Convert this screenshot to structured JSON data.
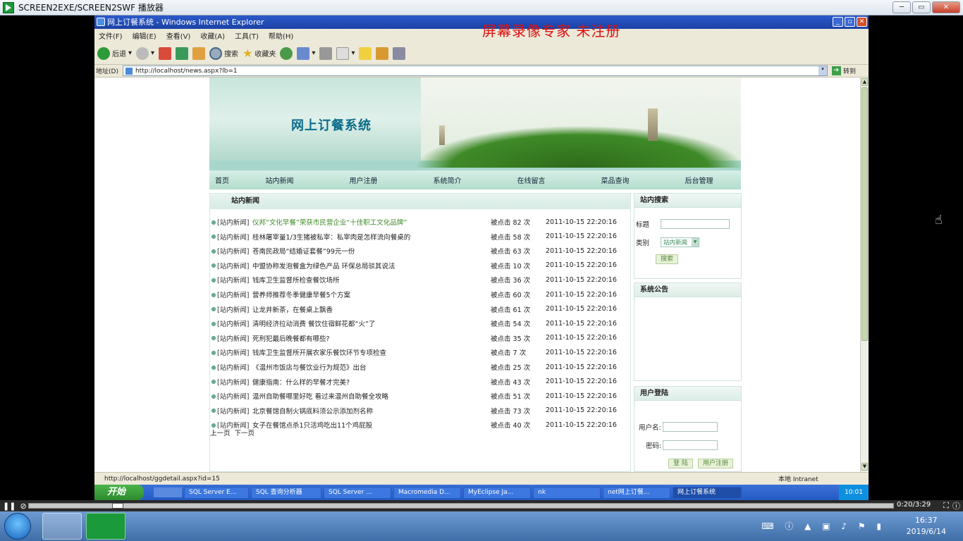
{
  "player": {
    "title": "SCREEN2EXE/SCREEN2SWF 播放器",
    "time": "0:20/3:29",
    "clock_time": "16:37",
    "clock_date": "2019/6/14"
  },
  "ie": {
    "title": "网上订餐系统 - Windows Internet Explorer",
    "watermark": "屏幕录像专家  未注册",
    "menu": [
      "文件(F)",
      "编辑(E)",
      "查看(V)",
      "收藏(A)",
      "工具(T)",
      "帮助(H)"
    ],
    "toolbar": {
      "back": "后退",
      "search": "搜索",
      "favorites": "收藏夹"
    },
    "address_label": "地址(D)",
    "address_value": "http://localhost/news.aspx?lb=1",
    "go_label": "转到",
    "status_url": "http://localhost/ggdetail.aspx?id=15",
    "status_zone": "本地 Intranet"
  },
  "site": {
    "title": "网上订餐系统",
    "nav": [
      "首页",
      "站内新闻",
      "用户注册",
      "系统简介",
      "在线留言",
      "菜品查询",
      "后台管理"
    ],
    "news_header": "站内新闻",
    "news": [
      {
        "cat": "[站内新闻]",
        "title": "仪邦“文化早餐”荣获市民营企业“十佳职工文化品牌”",
        "clicks": "被点击 82 次",
        "date": "2011-10-15 22:20:16"
      },
      {
        "cat": "[站内新闻]",
        "title": "桂林屠宰量1/3生猪被私宰：私宰肉是怎样流向餐桌的",
        "clicks": "被点击 58 次",
        "date": "2011-10-15 22:20:16"
      },
      {
        "cat": "[站内新闻]",
        "title": "苍南民政局“结婚证套餐”99元一份",
        "clicks": "被点击 63 次",
        "date": "2011-10-15 22:20:16"
      },
      {
        "cat": "[站内新闻]",
        "title": "中盟协称发泡餐盒为绿色产品 环保总局驳其说法",
        "clicks": "被点击 10 次",
        "date": "2011-10-15 22:20:16"
      },
      {
        "cat": "[站内新闻]",
        "title": "钱库卫生监督所检查餐饮场所",
        "clicks": "被点击 36 次",
        "date": "2011-10-15 22:20:16"
      },
      {
        "cat": "[站内新闻]",
        "title": "营养师推荐冬季健康早餐5个方案",
        "clicks": "被点击 60 次",
        "date": "2011-10-15 22:20:16"
      },
      {
        "cat": "[站内新闻]",
        "title": "让龙井新茶，在餐桌上飘香",
        "clicks": "被点击 61 次",
        "date": "2011-10-15 22:20:16"
      },
      {
        "cat": "[站内新闻]",
        "title": "清明经济拉动消费 餐饮住宿鲜花都“火”了",
        "clicks": "被点击 54 次",
        "date": "2011-10-15 22:20:16"
      },
      {
        "cat": "[站内新闻]",
        "title": "死刑犯最后晚餐都有哪些?",
        "clicks": "被点击 35 次",
        "date": "2011-10-15 22:20:16"
      },
      {
        "cat": "[站内新闻]",
        "title": "钱库卫生监督所开展农家乐餐饮环节专项检查",
        "clicks": "被点击 7 次",
        "date": "2011-10-15 22:20:16"
      },
      {
        "cat": "[站内新闻]",
        "title": "《温州市饭店与餐饮业行为规范》出台",
        "clicks": "被点击 25 次",
        "date": "2011-10-15 22:20:16"
      },
      {
        "cat": "[站内新闻]",
        "title": "健康指南：什么样的早餐才完美?",
        "clicks": "被点击 43 次",
        "date": "2011-10-15 22:20:16"
      },
      {
        "cat": "[站内新闻]",
        "title": "温州自助餐哪里好吃 看过来温州自助餐全攻略",
        "clicks": "被点击 51 次",
        "date": "2011-10-15 22:20:16"
      },
      {
        "cat": "[站内新闻]",
        "title": "北京餐馆自制火锅底料须公示添加剂名称",
        "clicks": "被点击 73 次",
        "date": "2011-10-15 22:20:16"
      },
      {
        "cat": "[站内新闻]",
        "title": "女子在餐馆点杀1只活鸡吃出11个鸡屁股",
        "clicks": "被点击 40 次",
        "date": "2011-10-15 22:20:16"
      }
    ],
    "pager": {
      "prev": "上一页",
      "next": "下一页"
    },
    "search": {
      "header": "站内搜索",
      "title_label": "标题",
      "type_label": "类别",
      "type_value": "站内新闻",
      "button": "搜索"
    },
    "notice": {
      "header": "系统公告"
    },
    "login": {
      "header": "用户登陆",
      "user_label": "用户名:",
      "pass_label": "密码:",
      "login_button": "登 陆",
      "register_button": "用户注册"
    }
  },
  "taskbar": {
    "start": "开始",
    "tasks": [
      "SQL Server E...",
      "SQL 查询分析器",
      "SQL Server ...",
      "Macromedia D...",
      "MyEclipse Ja...",
      "nk",
      "net网上订餐...",
      "网上订餐系统"
    ],
    "tray_time": "10:01"
  },
  "colors": {
    "accent": "#3f8a28",
    "nav_bg": "#b3dccd",
    "watermark": "#e01010"
  }
}
